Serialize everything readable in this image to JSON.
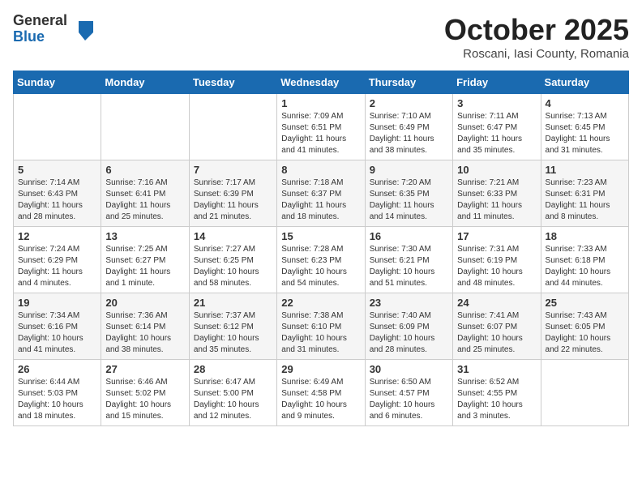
{
  "header": {
    "logo_general": "General",
    "logo_blue": "Blue",
    "month_title": "October 2025",
    "location": "Roscani, Iasi County, Romania"
  },
  "weekdays": [
    "Sunday",
    "Monday",
    "Tuesday",
    "Wednesday",
    "Thursday",
    "Friday",
    "Saturday"
  ],
  "weeks": [
    [
      {
        "day": "",
        "info": ""
      },
      {
        "day": "",
        "info": ""
      },
      {
        "day": "",
        "info": ""
      },
      {
        "day": "1",
        "info": "Sunrise: 7:09 AM\nSunset: 6:51 PM\nDaylight: 11 hours and 41 minutes."
      },
      {
        "day": "2",
        "info": "Sunrise: 7:10 AM\nSunset: 6:49 PM\nDaylight: 11 hours and 38 minutes."
      },
      {
        "day": "3",
        "info": "Sunrise: 7:11 AM\nSunset: 6:47 PM\nDaylight: 11 hours and 35 minutes."
      },
      {
        "day": "4",
        "info": "Sunrise: 7:13 AM\nSunset: 6:45 PM\nDaylight: 11 hours and 31 minutes."
      }
    ],
    [
      {
        "day": "5",
        "info": "Sunrise: 7:14 AM\nSunset: 6:43 PM\nDaylight: 11 hours and 28 minutes."
      },
      {
        "day": "6",
        "info": "Sunrise: 7:16 AM\nSunset: 6:41 PM\nDaylight: 11 hours and 25 minutes."
      },
      {
        "day": "7",
        "info": "Sunrise: 7:17 AM\nSunset: 6:39 PM\nDaylight: 11 hours and 21 minutes."
      },
      {
        "day": "8",
        "info": "Sunrise: 7:18 AM\nSunset: 6:37 PM\nDaylight: 11 hours and 18 minutes."
      },
      {
        "day": "9",
        "info": "Sunrise: 7:20 AM\nSunset: 6:35 PM\nDaylight: 11 hours and 14 minutes."
      },
      {
        "day": "10",
        "info": "Sunrise: 7:21 AM\nSunset: 6:33 PM\nDaylight: 11 hours and 11 minutes."
      },
      {
        "day": "11",
        "info": "Sunrise: 7:23 AM\nSunset: 6:31 PM\nDaylight: 11 hours and 8 minutes."
      }
    ],
    [
      {
        "day": "12",
        "info": "Sunrise: 7:24 AM\nSunset: 6:29 PM\nDaylight: 11 hours and 4 minutes."
      },
      {
        "day": "13",
        "info": "Sunrise: 7:25 AM\nSunset: 6:27 PM\nDaylight: 11 hours and 1 minute."
      },
      {
        "day": "14",
        "info": "Sunrise: 7:27 AM\nSunset: 6:25 PM\nDaylight: 10 hours and 58 minutes."
      },
      {
        "day": "15",
        "info": "Sunrise: 7:28 AM\nSunset: 6:23 PM\nDaylight: 10 hours and 54 minutes."
      },
      {
        "day": "16",
        "info": "Sunrise: 7:30 AM\nSunset: 6:21 PM\nDaylight: 10 hours and 51 minutes."
      },
      {
        "day": "17",
        "info": "Sunrise: 7:31 AM\nSunset: 6:19 PM\nDaylight: 10 hours and 48 minutes."
      },
      {
        "day": "18",
        "info": "Sunrise: 7:33 AM\nSunset: 6:18 PM\nDaylight: 10 hours and 44 minutes."
      }
    ],
    [
      {
        "day": "19",
        "info": "Sunrise: 7:34 AM\nSunset: 6:16 PM\nDaylight: 10 hours and 41 minutes."
      },
      {
        "day": "20",
        "info": "Sunrise: 7:36 AM\nSunset: 6:14 PM\nDaylight: 10 hours and 38 minutes."
      },
      {
        "day": "21",
        "info": "Sunrise: 7:37 AM\nSunset: 6:12 PM\nDaylight: 10 hours and 35 minutes."
      },
      {
        "day": "22",
        "info": "Sunrise: 7:38 AM\nSunset: 6:10 PM\nDaylight: 10 hours and 31 minutes."
      },
      {
        "day": "23",
        "info": "Sunrise: 7:40 AM\nSunset: 6:09 PM\nDaylight: 10 hours and 28 minutes."
      },
      {
        "day": "24",
        "info": "Sunrise: 7:41 AM\nSunset: 6:07 PM\nDaylight: 10 hours and 25 minutes."
      },
      {
        "day": "25",
        "info": "Sunrise: 7:43 AM\nSunset: 6:05 PM\nDaylight: 10 hours and 22 minutes."
      }
    ],
    [
      {
        "day": "26",
        "info": "Sunrise: 6:44 AM\nSunset: 5:03 PM\nDaylight: 10 hours and 18 minutes."
      },
      {
        "day": "27",
        "info": "Sunrise: 6:46 AM\nSunset: 5:02 PM\nDaylight: 10 hours and 15 minutes."
      },
      {
        "day": "28",
        "info": "Sunrise: 6:47 AM\nSunset: 5:00 PM\nDaylight: 10 hours and 12 minutes."
      },
      {
        "day": "29",
        "info": "Sunrise: 6:49 AM\nSunset: 4:58 PM\nDaylight: 10 hours and 9 minutes."
      },
      {
        "day": "30",
        "info": "Sunrise: 6:50 AM\nSunset: 4:57 PM\nDaylight: 10 hours and 6 minutes."
      },
      {
        "day": "31",
        "info": "Sunrise: 6:52 AM\nSunset: 4:55 PM\nDaylight: 10 hours and 3 minutes."
      },
      {
        "day": "",
        "info": ""
      }
    ]
  ]
}
